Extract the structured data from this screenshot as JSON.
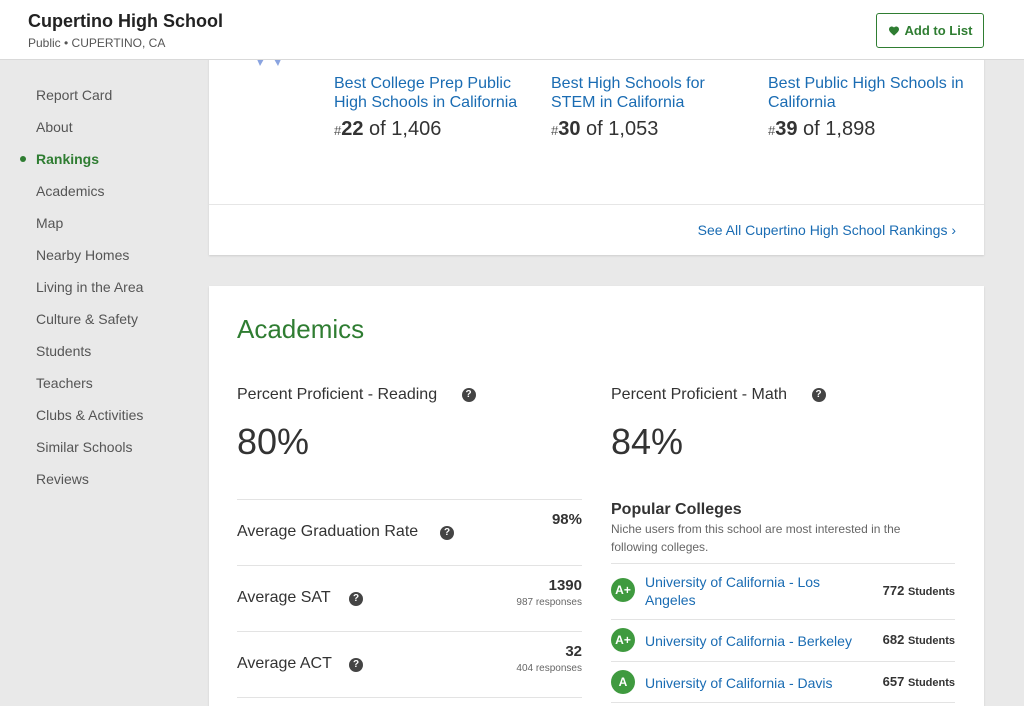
{
  "header": {
    "school_name": "Cupertino High School",
    "school_meta": "Public • CUPERTINO, CA",
    "add_button": "Add to List"
  },
  "sidebar": {
    "items": [
      {
        "label": "Report Card",
        "active": false
      },
      {
        "label": "About",
        "active": false
      },
      {
        "label": "Rankings",
        "active": true
      },
      {
        "label": "Academics",
        "active": false
      },
      {
        "label": "Map",
        "active": false
      },
      {
        "label": "Nearby Homes",
        "active": false
      },
      {
        "label": "Living in the Area",
        "active": false
      },
      {
        "label": "Culture & Safety",
        "active": false
      },
      {
        "label": "Students",
        "active": false
      },
      {
        "label": "Teachers",
        "active": false
      },
      {
        "label": "Clubs & Activities",
        "active": false
      },
      {
        "label": "Similar Schools",
        "active": false
      },
      {
        "label": "Reviews",
        "active": false
      }
    ]
  },
  "rankings": {
    "items": [
      {
        "title": "Best College Prep Public High Schools in California",
        "hash": "#",
        "rank": "22",
        "of": " of 1,406"
      },
      {
        "title": "Best High Schools for STEM in California",
        "hash": "#",
        "rank": "30",
        "of": " of 1,053"
      },
      {
        "title": "Best Public High Schools in California",
        "hash": "#",
        "rank": "39",
        "of": " of 1,898"
      }
    ],
    "see_all": "See All Cupertino High School Rankings ›"
  },
  "academics": {
    "title": "Academics",
    "reading_label": "Percent Proficient - Reading",
    "reading_value": "80%",
    "math_label": "Percent Proficient - Math",
    "math_value": "84%",
    "help_glyph": "?",
    "stats": [
      {
        "label": "Average Graduation Rate",
        "value": "98%",
        "sub": ""
      },
      {
        "label": "Average SAT",
        "value": "1390",
        "sub": "987 responses"
      },
      {
        "label": "Average ACT",
        "value": "32",
        "sub": "404 responses"
      }
    ]
  },
  "popular_colleges": {
    "title": "Popular Colleges",
    "description": "Niche users from this school are most interested in the following colleges.",
    "unit": "Students",
    "items": [
      {
        "grade": "A+",
        "name": "University of California - Los Angeles",
        "count": "772"
      },
      {
        "grade": "A+",
        "name": "University of California - Berkeley",
        "count": "682"
      },
      {
        "grade": "A",
        "name": "University of California - Davis",
        "count": "657"
      }
    ]
  },
  "colors": {
    "brand_green": "#2f7d32",
    "link_blue": "#1a6cb3",
    "grade_green": "#3f9a3f"
  }
}
